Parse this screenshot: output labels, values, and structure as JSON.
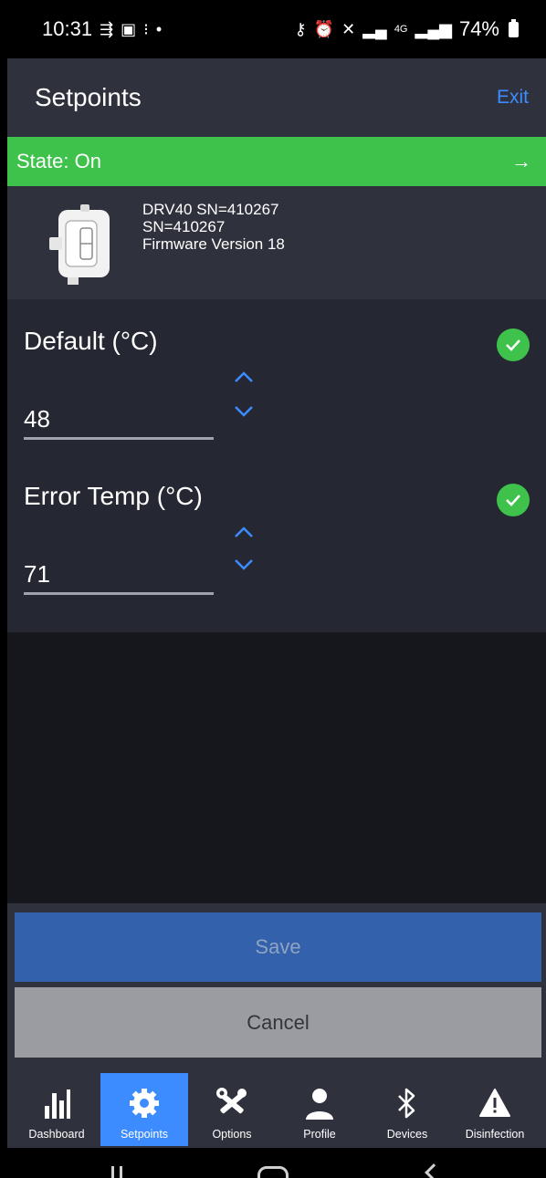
{
  "status_bar": {
    "time": "10:31",
    "network": "4G",
    "battery": "74%",
    "left_icons": [
      "usb-icon",
      "image-icon",
      "steps-icon",
      "dot-icon"
    ],
    "right_icons": [
      "vpn-key-icon",
      "alarm-icon",
      "mute-icon",
      "signal-icon",
      "signal-icon"
    ]
  },
  "header": {
    "title": "Setpoints",
    "exit_label": "Exit"
  },
  "state_bar": {
    "label": "State: On",
    "arrow": "→",
    "color": "#3ec24b"
  },
  "device": {
    "name": "DRV40 SN=410267",
    "serial": "SN=410267",
    "firmware": "Firmware Version 18"
  },
  "setpoints": [
    {
      "label": "Default (°C)",
      "value": "48",
      "valid": true
    },
    {
      "label": "Error Temp (°C)",
      "value": "71",
      "valid": true
    }
  ],
  "actions": {
    "save_label": "Save",
    "cancel_label": "Cancel"
  },
  "tabs": [
    {
      "label": "Dashboard",
      "icon": "bar-chart-icon",
      "active": false
    },
    {
      "label": "Setpoints",
      "icon": "gear-icon",
      "active": true
    },
    {
      "label": "Options",
      "icon": "tools-icon",
      "active": false
    },
    {
      "label": "Profile",
      "icon": "person-icon",
      "active": false
    },
    {
      "label": "Devices",
      "icon": "bluetooth-icon",
      "active": false
    },
    {
      "label": "Disinfection",
      "icon": "warning-icon",
      "active": false
    }
  ],
  "colors": {
    "accent": "#3d8cff",
    "success": "#3ec24b",
    "save_button": "#3361ab",
    "cancel_button": "#9a9ca1"
  }
}
